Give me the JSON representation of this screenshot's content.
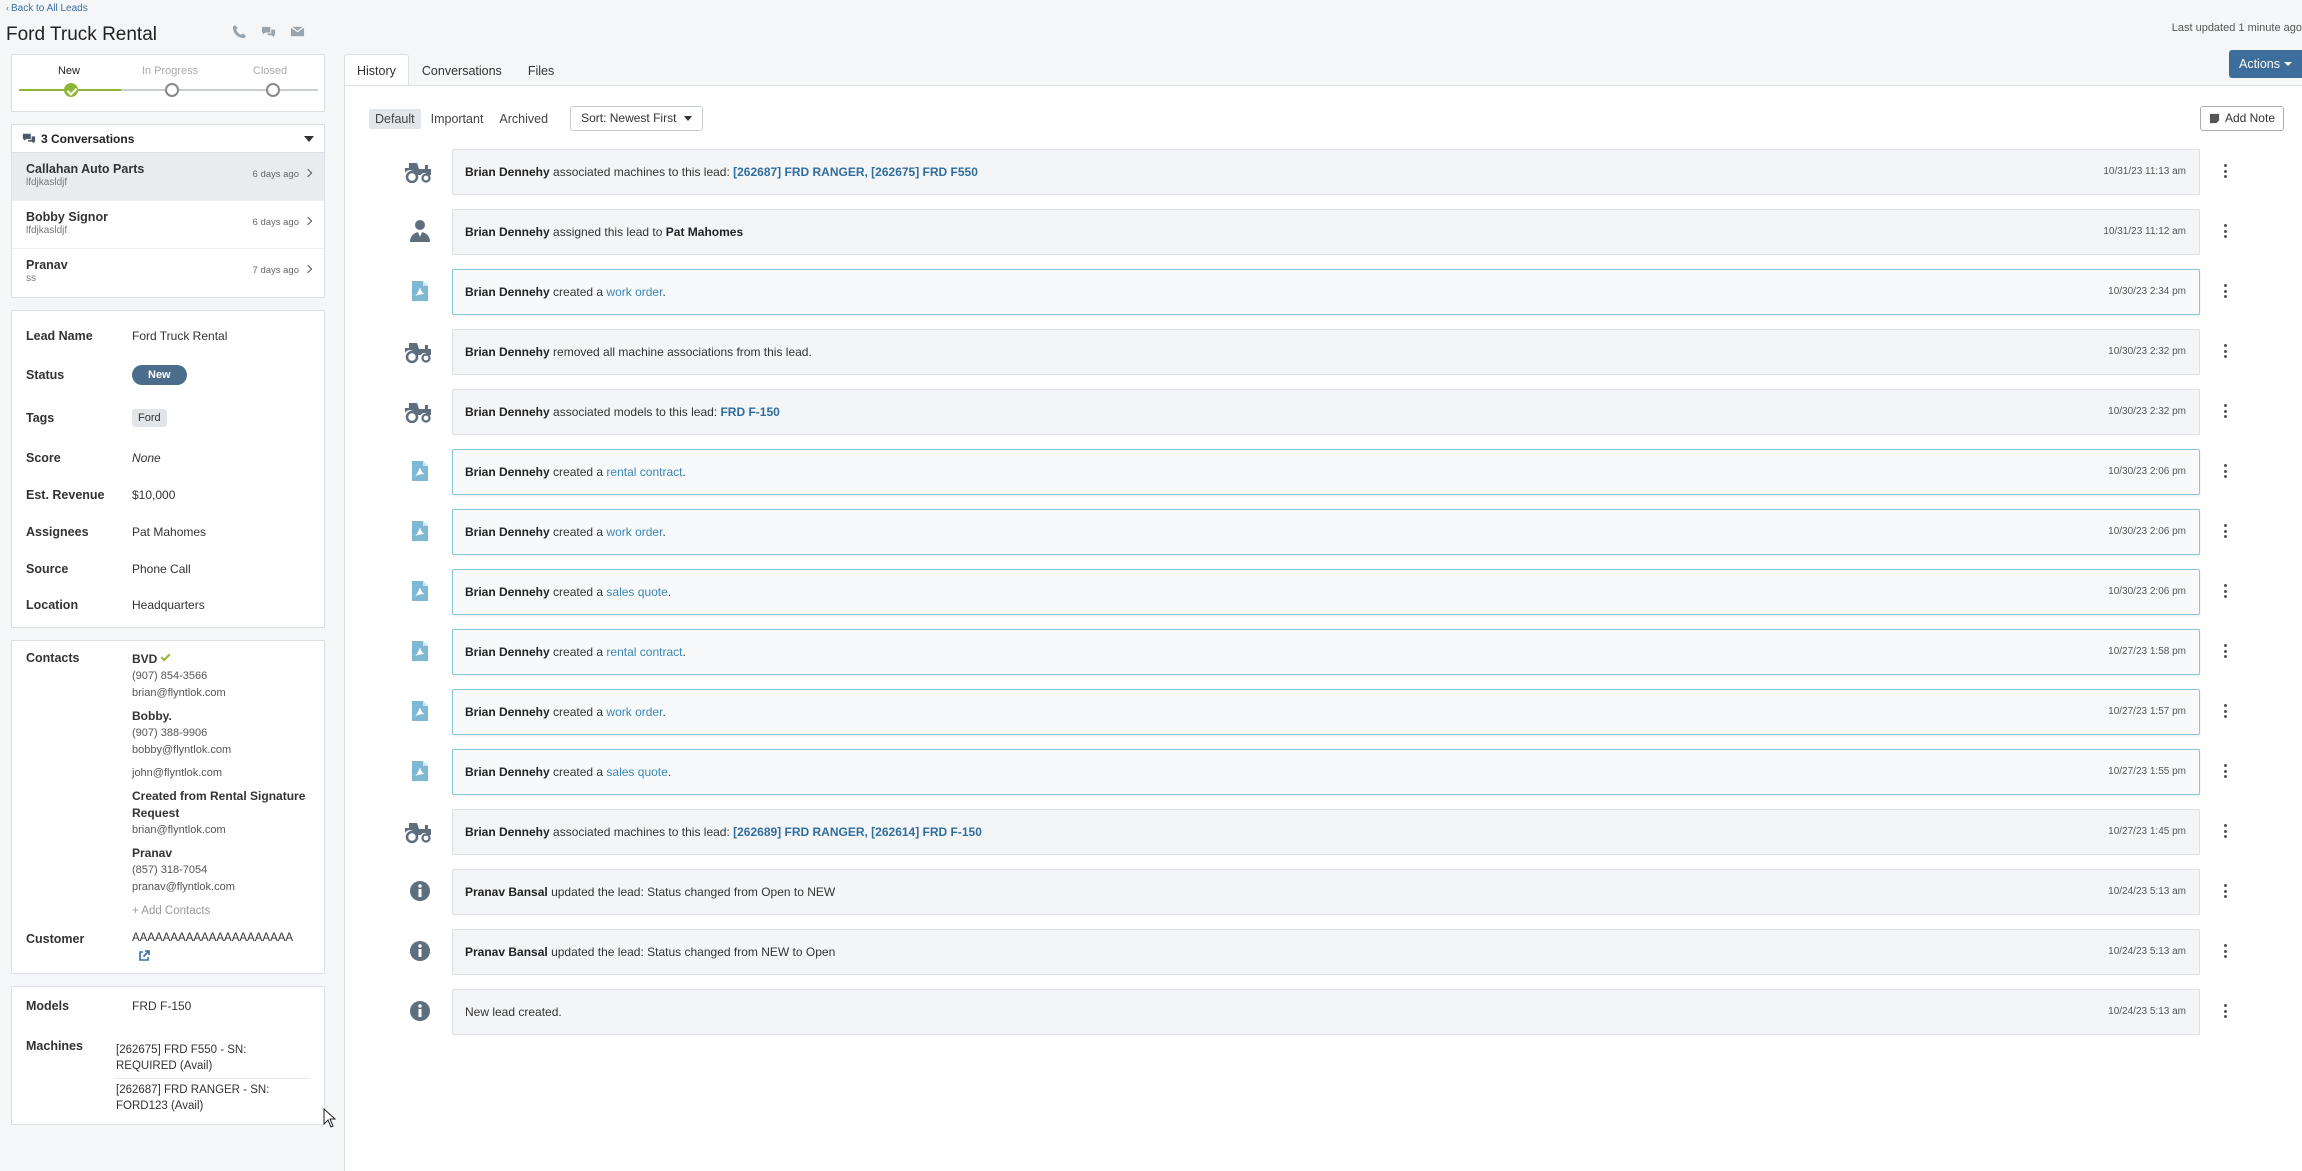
{
  "header": {
    "back_link": "Back to All Leads",
    "title": "Ford Truck Rental",
    "last_updated": "Last updated 1 minute ago"
  },
  "progress": {
    "stages": [
      "New",
      "In Progress",
      "Closed"
    ],
    "current": "New",
    "fill_fraction": 0.34
  },
  "conversations": {
    "header": "3 Conversations",
    "items": [
      {
        "name": "Callahan Auto Parts",
        "sub": "lfdjkasldjf",
        "time": "6 days ago"
      },
      {
        "name": "Bobby Signor",
        "sub": "lfdjkasldjf",
        "time": "6 days ago"
      },
      {
        "name": "Pranav",
        "sub": "ss",
        "time": "7 days ago"
      }
    ]
  },
  "details": {
    "lead_name_label": "Lead Name",
    "lead_name": "Ford Truck Rental",
    "status_label": "Status",
    "status": "New",
    "tags_label": "Tags",
    "tag": "Ford",
    "score_label": "Score",
    "score": "None",
    "revenue_label": "Est. Revenue",
    "revenue": "$10,000",
    "assignees_label": "Assignees",
    "assignees": "Pat Mahomes",
    "source_label": "Source",
    "source": "Phone Call",
    "location_label": "Location",
    "location": "Headquarters"
  },
  "contacts": {
    "label": "Contacts",
    "c1_name": "BVD",
    "c1_phone": "(907) 854-3566",
    "c1_email": "brian@flyntlok.com",
    "c2_name": "Bobby.",
    "c2_phone": "(907) 388-9906",
    "c2_email": "bobby@flyntlok.com",
    "c3_email": "john@flyntlok.com",
    "c4_name": "Created from Rental Signature Request",
    "c4_email": "brian@flyntlok.com",
    "c5_name": "Pranav",
    "c5_phone": "(857) 318-7054",
    "c5_email": "pranav@flyntlok.com",
    "add_contacts": "+ Add Contacts",
    "customer_label": "Customer",
    "customer_value": "AAAAAAAAAAAAAAAAAAAAA"
  },
  "models": {
    "models_label": "Models",
    "model": "FRD F-150",
    "machines_label": "Machines",
    "machine_1": "[262675] FRD F550 - SN: REQUIRED (Avail)",
    "machine_2": "[262687] FRD RANGER - SN: FORD123 (Avail)"
  },
  "tabs": {
    "history": "History",
    "conversations": "Conversations",
    "files": "Files"
  },
  "actions_label": "Actions",
  "filters": {
    "default": "Default",
    "important": "Important",
    "archived": "Archived",
    "sort": "Sort: Newest First"
  },
  "add_note": "Add Note",
  "history": [
    {
      "actor": "Brian Dennehy",
      "text": "associated machines to this lead:",
      "link": "[262687] FRD RANGER, [262675] FRD F550",
      "time": "10/31/23 11:13 am"
    },
    {
      "actor": "Brian Dennehy",
      "text": "assigned this lead to",
      "bold": "Pat Mahomes",
      "time": "10/31/23 11:12 am"
    },
    {
      "actor": "Brian Dennehy",
      "text": "created a",
      "link": "work order",
      "end": ".",
      "time": "10/30/23 2:34 pm"
    },
    {
      "actor": "Brian Dennehy",
      "text": "removed all machine associations from this lead.",
      "time": "10/30/23 2:32 pm"
    },
    {
      "actor": "Brian Dennehy",
      "text": "associated models to this lead:",
      "link": "FRD F-150",
      "time": "10/30/23 2:32 pm"
    },
    {
      "actor": "Brian Dennehy",
      "text": "created a",
      "link": "rental contract",
      "end": ".",
      "time": "10/30/23 2:06 pm"
    },
    {
      "actor": "Brian Dennehy",
      "text": "created a",
      "link": "work order",
      "end": ".",
      "time": "10/30/23 2:06 pm"
    },
    {
      "actor": "Brian Dennehy",
      "text": "created a",
      "link": "sales quote",
      "end": ".",
      "time": "10/30/23 2:06 pm"
    },
    {
      "actor": "Brian Dennehy",
      "text": "created a",
      "link": "rental contract",
      "end": ".",
      "time": "10/27/23 1:58 pm"
    },
    {
      "actor": "Brian Dennehy",
      "text": "created a",
      "link": "work order",
      "end": ".",
      "time": "10/27/23 1:57 pm"
    },
    {
      "actor": "Brian Dennehy",
      "text": "created a",
      "link": "sales quote",
      "end": ".",
      "time": "10/27/23 1:55 pm"
    },
    {
      "actor": "Brian Dennehy",
      "text": "associated machines to this lead:",
      "link": "[262689] FRD RANGER, [262614] FRD F-150",
      "time": "10/27/23 1:45 pm"
    },
    {
      "actor": "Pranav Bansal",
      "text": "updated the lead: Status changed from Open to NEW",
      "time": "10/24/23 5:13 am"
    },
    {
      "actor": "Pranav Bansal",
      "text": "updated the lead: Status changed from NEW to Open",
      "time": "10/24/23 5:13 am"
    },
    {
      "actor": "",
      "text": "New lead created.",
      "time": "10/24/23 5:13 am"
    }
  ]
}
